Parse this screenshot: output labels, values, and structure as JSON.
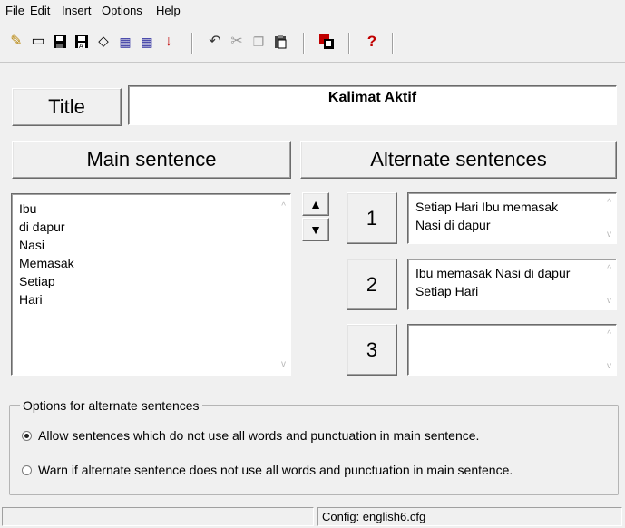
{
  "menu": [
    "File",
    "Edit",
    "Insert",
    "Options",
    "Help"
  ],
  "toolbar": {
    "group1": [
      "new-icon",
      "open-icon",
      "save-icon",
      "save-as-icon",
      "erase-icon",
      "scramble-icon",
      "unscramble-icon",
      "insert-down-icon"
    ],
    "group2": [
      "undo-icon",
      "cut-icon",
      "copy-icon",
      "paste-icon"
    ],
    "group3": [
      "preview-icon"
    ],
    "group4": [
      "help-icon"
    ]
  },
  "title": {
    "label": "Title",
    "value": "Kalimat Aktif"
  },
  "main": {
    "header": "Main sentence",
    "words": [
      "Ibu",
      "di dapur",
      "Nasi",
      "Memasak",
      "Setiap",
      "Hari"
    ]
  },
  "alternates": {
    "header": "Alternate sentences",
    "items": [
      {
        "number": "1",
        "text": "Setiap Hari Ibu memasak Nasi di dapur"
      },
      {
        "number": "2",
        "text": "Ibu memasak Nasi di dapur Setiap Hari"
      },
      {
        "number": "3",
        "text": ""
      }
    ]
  },
  "options": {
    "legend": "Options for alternate sentences",
    "allow": "Allow sentences which do not use all words and punctuation in main sentence.",
    "warn": "Warn if alternate sentence does not use all words and punctuation in main sentence.",
    "selected": "allow"
  },
  "status": {
    "left": "",
    "config": "Config: english6.cfg"
  }
}
